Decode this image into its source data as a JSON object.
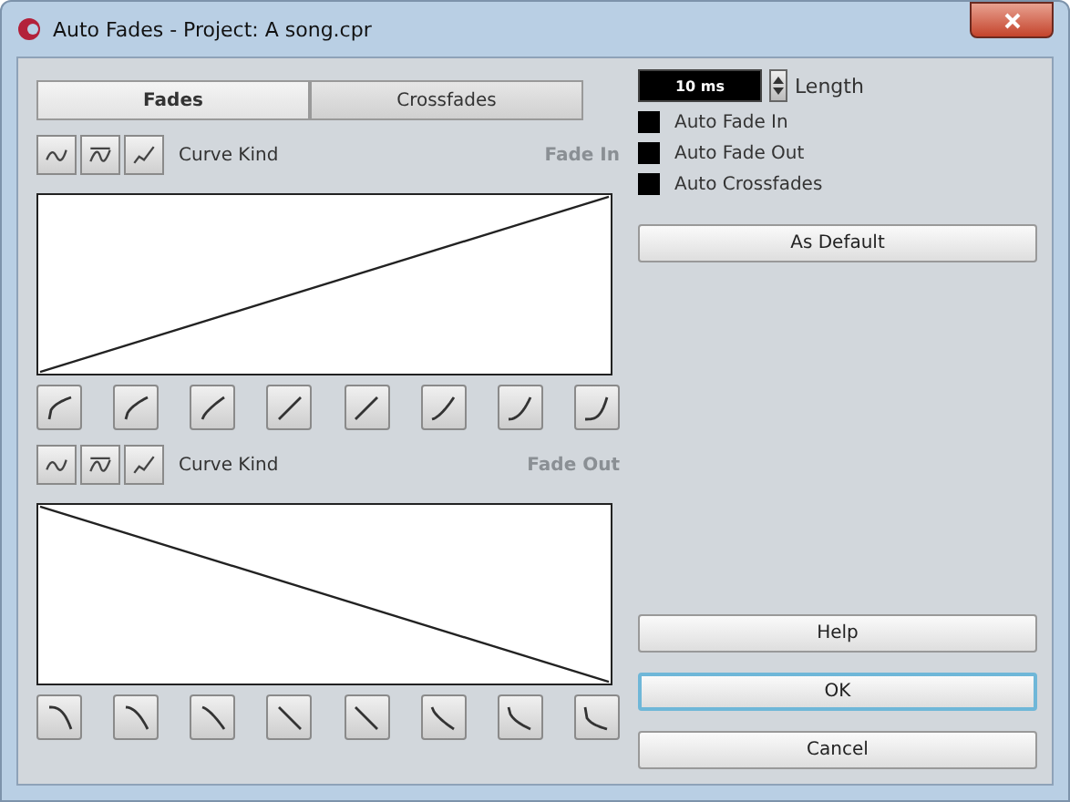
{
  "window": {
    "title": "Auto Fades - Project: A song.cpr"
  },
  "tabs": [
    {
      "label": "Fades",
      "selected": true
    },
    {
      "label": "Crossfades",
      "selected": false
    }
  ],
  "sections": [
    {
      "kind": "in",
      "curve_kind_label": "Curve Kind",
      "title": "Fade In"
    },
    {
      "kind": "out",
      "curve_kind_label": "Curve Kind",
      "title": "Fade Out"
    }
  ],
  "length": {
    "value": "10 ms",
    "label": "Length"
  },
  "options": [
    {
      "label": "Auto Fade In",
      "checked": false
    },
    {
      "label": "Auto Fade Out",
      "checked": false
    },
    {
      "label": "Auto Crossfades",
      "checked": false
    }
  ],
  "as_default_button": "As Default",
  "buttons": [
    {
      "label": "Help",
      "focused": false
    },
    {
      "label": "OK",
      "focused": true
    },
    {
      "label": "Cancel",
      "focused": false
    }
  ]
}
